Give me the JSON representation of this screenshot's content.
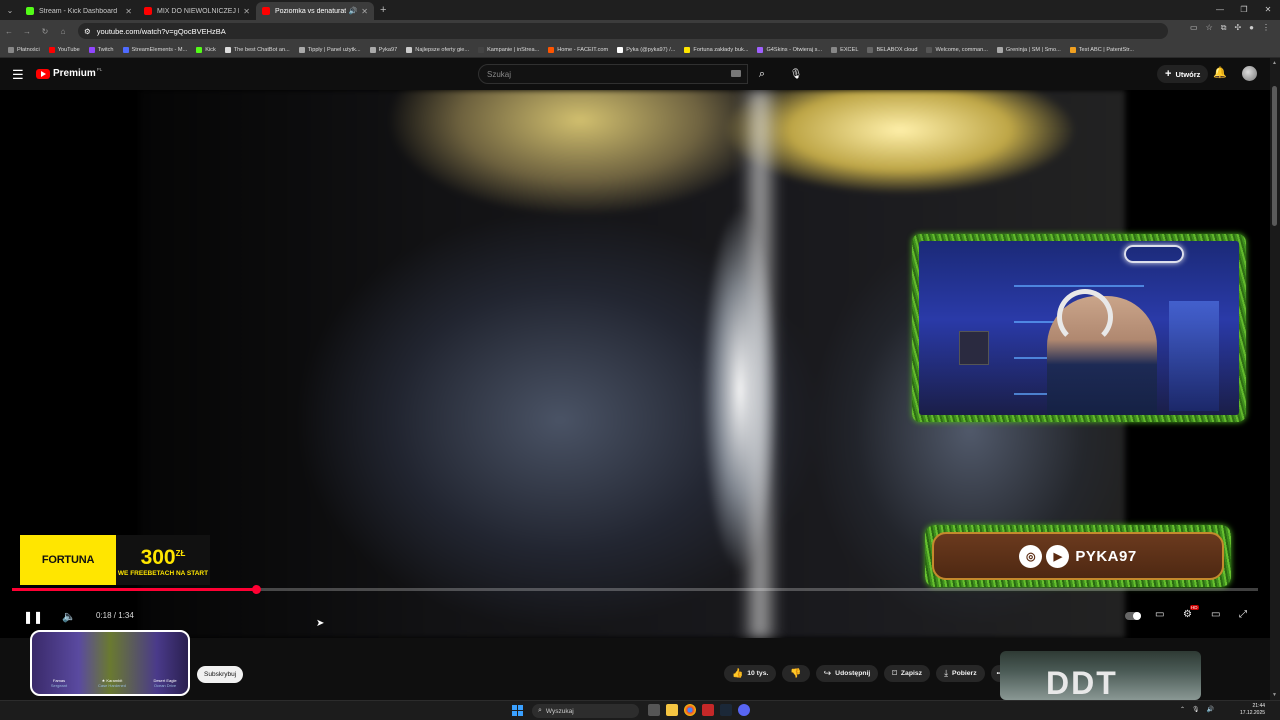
{
  "browser": {
    "tabs": [
      {
        "title": "Stream - Kick Dashboard",
        "color": "#53fc18",
        "active": false
      },
      {
        "title": "MIX DO NIEWOLNICZEJ PRACY",
        "color": "#ff0000",
        "active": false
      },
      {
        "title": "Poziomka vs denaturat - Yo",
        "color": "#ff0000",
        "active": true
      }
    ],
    "url": "youtube.com/watch?v=gQocBVEHzBA",
    "bookmarks": [
      {
        "label": "Płatności",
        "color": "#888"
      },
      {
        "label": "YouTube",
        "color": "#ff0000"
      },
      {
        "label": "Twitch",
        "color": "#9146ff"
      },
      {
        "label": "StreamElements - M...",
        "color": "#4f6bff"
      },
      {
        "label": "Kick",
        "color": "#53fc18"
      },
      {
        "label": "The best ChatBot an...",
        "color": "#ddd"
      },
      {
        "label": "Tipply | Panel użytk...",
        "color": "#aaa"
      },
      {
        "label": "Pyka97",
        "color": "#aaa"
      },
      {
        "label": "Najlepsze oferty gie...",
        "color": "#ccc"
      },
      {
        "label": "Kampanie | inStrea...",
        "color": "#444"
      },
      {
        "label": "Home - FACEIT.com",
        "color": "#ff5500"
      },
      {
        "label": "Pyka (@pyka97) /...",
        "color": "#fff"
      },
      {
        "label": "Fortuna zakłady buk...",
        "color": "#ffe600"
      },
      {
        "label": "G4Skins - Otwieraj s...",
        "color": "#a060ff"
      },
      {
        "label": "EXCEL",
        "color": "#888"
      },
      {
        "label": "BELABOX cloud",
        "color": "#666"
      },
      {
        "label": "Welcome, comman...",
        "color": "#555"
      },
      {
        "label": "Greninja | SM | Smo...",
        "color": "#aaa"
      },
      {
        "label": "Test ABC | PatentStr...",
        "color": "#f0a020"
      }
    ]
  },
  "youtube": {
    "logo_text": "Premium",
    "logo_country": "PL",
    "search_placeholder": "Szukaj",
    "create_label": "Utwórz"
  },
  "video": {
    "time_display": "0:18 / 1:34",
    "progress": 0.196,
    "ad": {
      "brand": "FORTUNA",
      "amount": "300",
      "amount_unit": "ZŁ",
      "tagline": "WE FREEBETACH NA START"
    },
    "overlay": {
      "handle": "PYKA97"
    },
    "hd_badge": "HD"
  },
  "below": {
    "subscribe_label": "Subskrybuj",
    "like_label": "10 tys.",
    "share_label": "Udostępnij",
    "save_label": "Zapisz",
    "download_label": "Pobierz",
    "ad_items": [
      {
        "name": "Famas",
        "sub": "Sergeant"
      },
      {
        "name": "★ Karambit",
        "sub": "Case Hardened"
      },
      {
        "name": "Desert Eagle",
        "sub": "Ocean Drive"
      }
    ],
    "recommended_text": "DDT"
  },
  "taskbar": {
    "search_placeholder": "Wyszukaj",
    "time": "21:44",
    "date": "17.12.2025"
  }
}
